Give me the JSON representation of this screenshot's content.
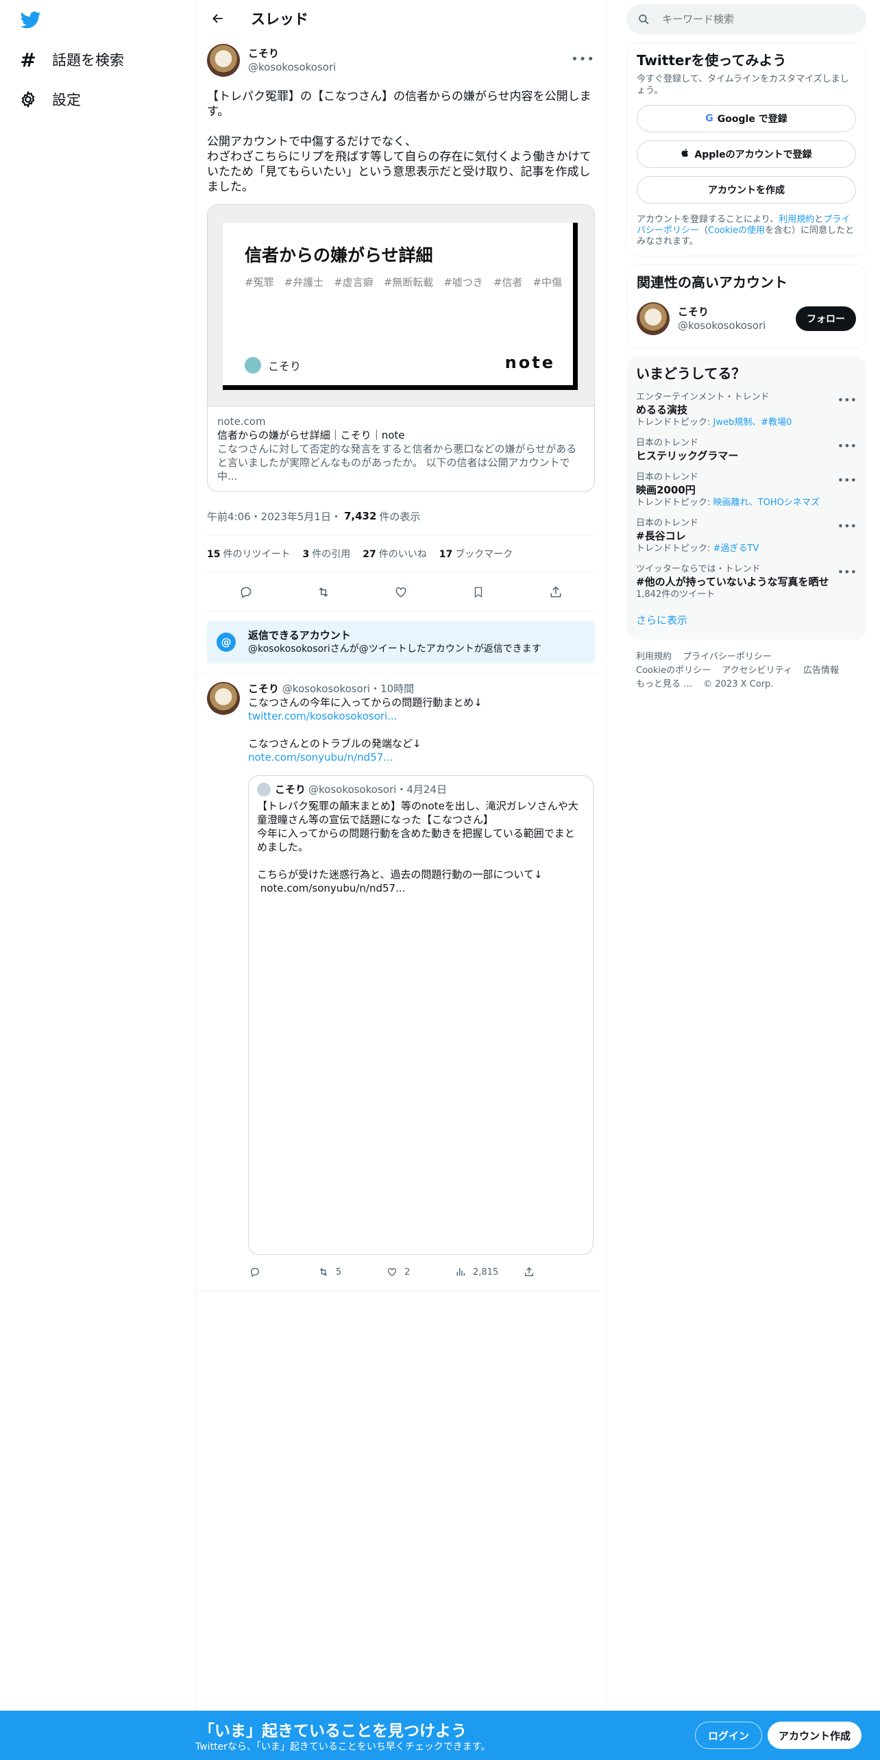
{
  "nav": {
    "logo": "twitter-bird-icon",
    "items": [
      {
        "label": "話題を検索",
        "icon": "hashtag-icon"
      },
      {
        "label": "設定",
        "icon": "gear-icon"
      }
    ]
  },
  "header": {
    "title": "スレッド"
  },
  "tweet": {
    "name": "こそり",
    "handle": "@kosokosokosori",
    "text": "【トレパク冤罪】の【こなつさん】の信者からの嫌がらせ内容を公開します。\n\n公開アカウントで中傷するだけでなく、\nわざわざこちらにリプを飛ばす等して自らの存在に気付くよう働きかけていたため「見てもらいたい」という意思表示だと受け取り、記事を作成しました。",
    "card": {
      "image_title": "信者からの嫌がらせ詳細",
      "image_tags": "#冤罪　#弁護士　#虚言癖　#無断転載　#嘘つき　#信者　#中傷",
      "image_author": "こそり",
      "image_brand": "note",
      "domain": "note.com",
      "title": "信者からの嫌がらせ詳細｜こそり｜note",
      "description": "こなつさんに対して否定的な発言をすると信者から悪口などの嫌がらせがあると言いましたが実際どんなものがあったか。 以下の信者は公開アカウントで中..."
    },
    "timestamp": "午前4:06・2023年5月1日・",
    "views_count": "7,432",
    "views_label": "件の表示",
    "stats": {
      "retweets": "15",
      "retweets_label": "件のリツイート",
      "quotes": "3",
      "quotes_label": "件の引用",
      "likes": "27",
      "likes_label": "件のいいね",
      "bookmarks": "17",
      "bookmarks_label": "ブックマーク"
    },
    "reply_notice": {
      "title": "返信できるアカウント",
      "sub": "@kosokosokosoriさんが@ツイートしたアカウントが返信できます"
    }
  },
  "reply": {
    "name": "こそり",
    "meta": "@kosokosokosori・10時間",
    "line1": "こなつさんの今年に入ってからの問題行動まとめ↓",
    "link1": "twitter.com/kosokosokosori...",
    "line2": "こなつさんとのトラブルの発端など↓",
    "link2": "note.com/sonyubu/n/nd57...",
    "quote": {
      "name": "こそり",
      "meta": "@kosokosokosori・4月24日",
      "text": "【トレパク冤罪の顛末まとめ】等のnoteを出し、滝沢ガレソさんや大童澄瞳さん等の宣伝で話題になった【こなつさん】\n今年に入ってからの問題行動を含めた動きを把握している範囲でまとめました。\n\nこちらが受けた迷惑行為と、過去の問題行動の一部について↓\n note.com/sonyubu/n/nd57..."
    },
    "actions": {
      "retweets": "5",
      "likes": "2",
      "views": "2,815"
    }
  },
  "sidebar": {
    "search_placeholder": "キーワード検索",
    "signup": {
      "title": "Twitterを使ってみよう",
      "sub": "今すぐ登録して、タイムラインをカスタマイズしましょう。",
      "google": "Google で登録",
      "apple": "Appleのアカウントで登録",
      "create": "アカウントを作成",
      "legal_1": "アカウントを登録することにより、",
      "legal_terms": "利用規約",
      "legal_2": "と",
      "legal_privacy": "プライバシーポリシー",
      "legal_3": "（",
      "legal_cookie": "Cookieの使用",
      "legal_4": "を含む）に同意したとみなされます。"
    },
    "related": {
      "title": "関連性の高いアカウント",
      "name": "こそり",
      "handle": "@kosokosokosori",
      "follow": "フォロー"
    },
    "trends": {
      "title": "いまどうしてる？",
      "items": [
        {
          "meta": "エンターテインメント・トレンド",
          "name": "めるる演技",
          "topic_prefix": "トレンドトピック: ",
          "topic": "Jweb規制、#教場0"
        },
        {
          "meta": "日本のトレンド",
          "name": "ヒステリックグラマー",
          "topic_prefix": "",
          "topic": ""
        },
        {
          "meta": "日本のトレンド",
          "name": "映画2000円",
          "topic_prefix": "トレンドトピック: ",
          "topic": "映画離れ、TOHOシネマズ"
        },
        {
          "meta": "日本のトレンド",
          "name": "#長谷コレ",
          "topic_prefix": "トレンドトピック: ",
          "topic": "#過ぎるTV"
        },
        {
          "meta": "ツイッターならでは・トレンド",
          "name": "#他の人が持っていないような写真を晒せ",
          "topic_prefix": "1,842件のツイート",
          "topic": ""
        }
      ],
      "show_more": "さらに表示"
    },
    "footer": {
      "terms": "利用規約",
      "privacy": "プライバシーポリシー",
      "cookie": "Cookieのポリシー",
      "accessibility": "アクセシビリティ",
      "ads": "広告情報",
      "more": "もっと見る …",
      "copyright": "© 2023 X Corp."
    }
  },
  "bottom_bar": {
    "title": "「いま」起きていることを見つけよう",
    "sub": "Twitterなら、「いま」起きていることをいち早くチェックできます。",
    "login": "ログイン",
    "signup": "アカウント作成"
  },
  "colors": {
    "accent": "#1d9bf0",
    "text": "#0f1419",
    "muted": "#536471"
  }
}
